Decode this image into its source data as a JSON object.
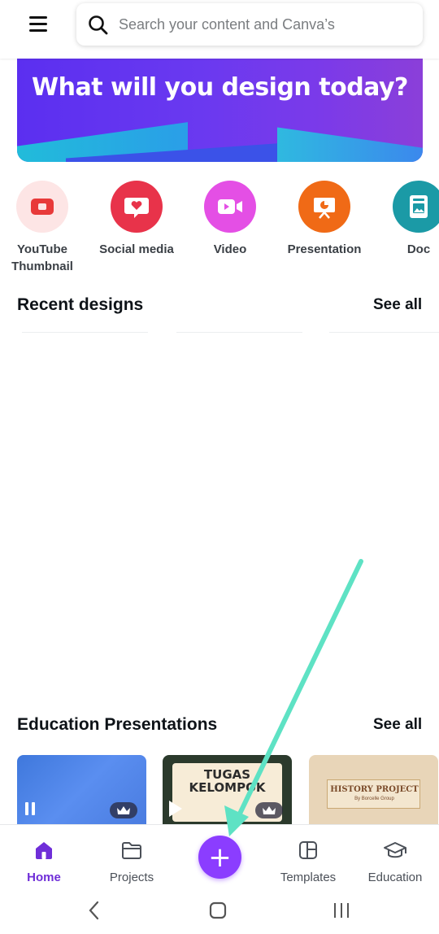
{
  "search": {
    "placeholder": "Search your content and Canva’s"
  },
  "hero": {
    "title": "What will you design today?"
  },
  "design_types": [
    {
      "label": "YouTube Thumbnail",
      "icon": "youtube-icon",
      "bg": "#fde5e5",
      "fg": "#e83a3a"
    },
    {
      "label": "Social media",
      "icon": "heart-chat-icon",
      "bg": "#e8334a",
      "fg": "#ffffff"
    },
    {
      "label": "Video",
      "icon": "video-camera-icon",
      "bg": "#e44fe5",
      "fg": "#ffffff"
    },
    {
      "label": "Presentation",
      "icon": "presentation-icon",
      "bg": "#f06a16",
      "fg": "#ffffff"
    },
    {
      "label": "Doc",
      "icon": "doc-icon",
      "bg": "#1b9aa6",
      "fg": "#ffffff"
    }
  ],
  "recent": {
    "title": "Recent designs",
    "see_all": "See all"
  },
  "education": {
    "title": "Education Presentations",
    "see_all": "See all",
    "cards": [
      {
        "name": "Blue gradient presentation"
      },
      {
        "name": "Tugas Kelompok",
        "text": "TUGAS KELOMPOK"
      },
      {
        "name": "History Project",
        "text": "HISTORY PROJECT",
        "sub": "By Borcelle Group"
      }
    ]
  },
  "nav": {
    "home": "Home",
    "projects": "Projects",
    "create": "+",
    "templates": "Templates",
    "education": "Education"
  },
  "colors": {
    "accent": "#8b3dff",
    "active_nav": "#6f2ed8",
    "arrow": "#5ee2c4"
  }
}
